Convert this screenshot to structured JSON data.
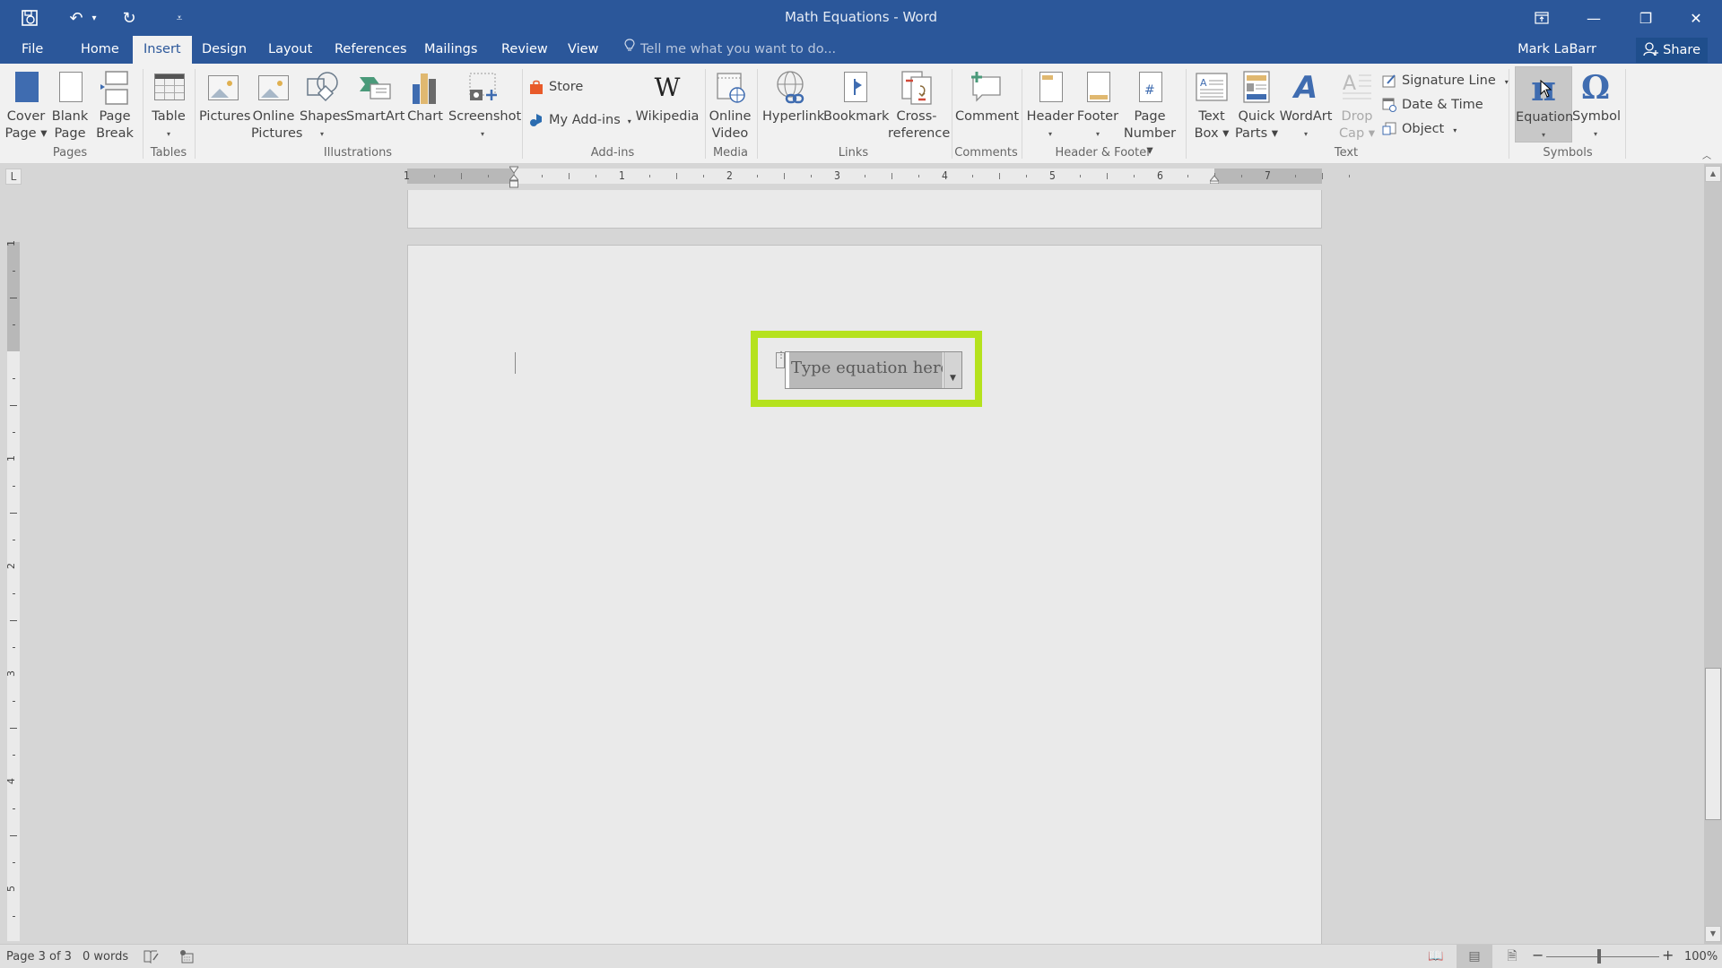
{
  "window": {
    "title": "Math Equations - Word",
    "controls": {
      "ribbon_display": "⊼",
      "minimize": "—",
      "restore": "❐",
      "close": "✕"
    }
  },
  "quick_access": {
    "save_icon": "save-sync-icon",
    "undo_icon": "↶",
    "undo_dropdown": "▾",
    "redo_icon": "↻",
    "customize": "⩡"
  },
  "tabs": [
    {
      "label": "File"
    },
    {
      "label": "Home"
    },
    {
      "label": "Insert",
      "active": true
    },
    {
      "label": "Design"
    },
    {
      "label": "Layout"
    },
    {
      "label": "References"
    },
    {
      "label": "Mailings"
    },
    {
      "label": "Review"
    },
    {
      "label": "View"
    }
  ],
  "tell_me": {
    "placeholder": "Tell me what you want to do...",
    "icon": "💡"
  },
  "user": {
    "name": "Mark LaBarr",
    "share_label": "Share"
  },
  "ribbon": {
    "groups": {
      "pages": "Pages",
      "tables": "Tables",
      "illustrations": "Illustrations",
      "addins": "Add-ins",
      "media": "Media",
      "links": "Links",
      "comments": "Comments",
      "header_footer": "Header & Footer",
      "text": "Text",
      "symbols": "Symbols"
    },
    "buttons": {
      "cover_page": [
        "Cover",
        "Page ▾"
      ],
      "blank_page": [
        "Blank",
        "Page"
      ],
      "page_break": [
        "Page",
        "Break"
      ],
      "table": [
        "Table",
        "▾"
      ],
      "pictures": [
        "Pictures",
        ""
      ],
      "online_pictures": [
        "Online",
        "Pictures"
      ],
      "shapes": [
        "Shapes",
        "▾"
      ],
      "smartart": [
        "SmartArt",
        ""
      ],
      "chart": [
        "Chart",
        ""
      ],
      "screenshot": [
        "Screenshot",
        "▾"
      ],
      "store": "Store",
      "my_addins": "My Add-ins",
      "wikipedia": "Wikipedia",
      "online_video": [
        "Online",
        "Video"
      ],
      "hyperlink": "Hyperlink",
      "bookmark": "Bookmark",
      "cross_reference": [
        "Cross-",
        "reference"
      ],
      "comment": "Comment",
      "header": [
        "Header",
        "▾"
      ],
      "footer": [
        "Footer",
        "▾"
      ],
      "page_number": [
        "Page",
        "Number ▾"
      ],
      "text_box": [
        "Text",
        "Box ▾"
      ],
      "quick_parts": [
        "Quick",
        "Parts ▾"
      ],
      "wordart": [
        "WordArt",
        "▾"
      ],
      "drop_cap": [
        "Drop",
        "Cap ▾"
      ],
      "signature_line": "Signature Line",
      "date_time": "Date & Time",
      "object": "Object",
      "equation": [
        "Equation",
        "▾"
      ],
      "symbol": [
        "Symbol",
        "▾"
      ]
    },
    "glyphs": {
      "wikipedia": "W",
      "wordart": "A",
      "equation": "π",
      "symbol": "Ω",
      "page_number": "#"
    }
  },
  "rulers": {
    "corner_tab": "L",
    "horizontal_labels": [
      "1",
      "1",
      "2",
      "3",
      "4",
      "5",
      "6",
      "7"
    ],
    "vertical_labels": [
      "1",
      "1",
      "2",
      "3",
      "4",
      "5"
    ]
  },
  "document": {
    "equation_placeholder": "Type equation here.",
    "highlight_color": "#b5e21e"
  },
  "status": {
    "page": "Page 3 of 3",
    "words": "0 words",
    "zoom_percent": "100%",
    "zoom_value": 100,
    "active_view": "print-layout"
  },
  "scrollbar": {
    "up": "▲",
    "down": "▼",
    "position_fraction": 0.66
  },
  "colors": {
    "brand": "#2b579a",
    "ribbon_bg": "#f1f1f1",
    "highlight": "#b5e21e"
  }
}
